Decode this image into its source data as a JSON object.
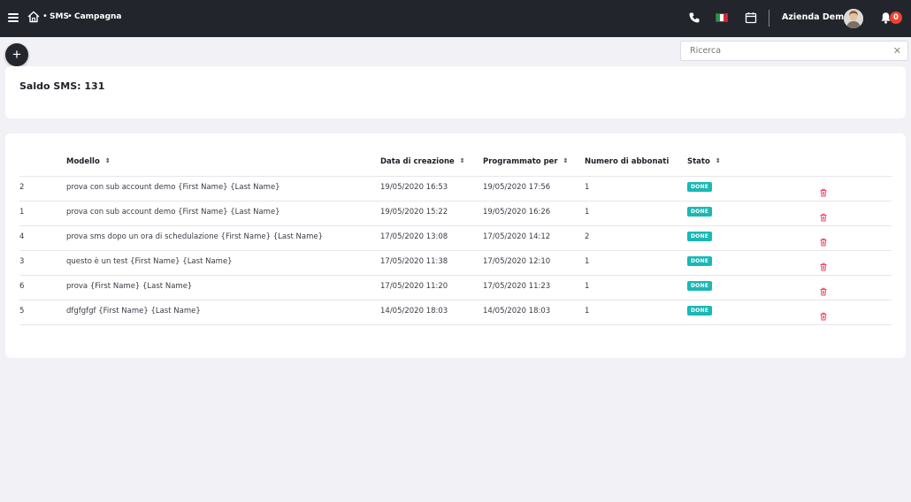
{
  "header": {
    "breadcrumb": [
      "SMS",
      "Campagna"
    ],
    "company_name": "Azienda Demo",
    "notification_count": "0",
    "icons": [
      "menu-icon",
      "home-icon",
      "phone-icon",
      "italian-flag-icon",
      "calendar-icon",
      "bell-icon"
    ]
  },
  "search": {
    "placeholder": "Ricerca",
    "value": ""
  },
  "balance": {
    "label": "Saldo SMS: 131"
  },
  "table": {
    "columns": [
      "Modello",
      "Data di creazione",
      "Programmato per",
      "Numero di abbonati",
      "Stato"
    ],
    "rows": [
      {
        "id": "2",
        "model": "prova con sub account demo {First Name} {Last Name}",
        "created": "19/05/2020 16:53",
        "scheduled": "19/05/2020 17:56",
        "subscribers": "1",
        "status": "DONE"
      },
      {
        "id": "1",
        "model": "prova con sub account demo {First Name} {Last Name}",
        "created": "19/05/2020 15:22",
        "scheduled": "19/05/2020 16:26",
        "subscribers": "1",
        "status": "DONE"
      },
      {
        "id": "4",
        "model": "prova sms dopo un ora di schedulazione {First Name} {Last Name}",
        "created": "17/05/2020 13:08",
        "scheduled": "17/05/2020 14:12",
        "subscribers": "2",
        "status": "DONE"
      },
      {
        "id": "3",
        "model": "questo è un test {First Name} {Last Name}",
        "created": "17/05/2020 11:38",
        "scheduled": "17/05/2020 12:10",
        "subscribers": "1",
        "status": "DONE"
      },
      {
        "id": "6",
        "model": "prova {First Name} {Last Name}",
        "created": "17/05/2020 11:20",
        "scheduled": "17/05/2020 11:23",
        "subscribers": "1",
        "status": "DONE"
      },
      {
        "id": "5",
        "model": "dfgfgfgf {First Name} {Last Name}",
        "created": "14/05/2020 18:03",
        "scheduled": "14/05/2020 18:03",
        "subscribers": "1",
        "status": "DONE"
      }
    ]
  },
  "colors": {
    "topbar": "#23252c",
    "status_done": "#1ab8b5",
    "badge": "#f0412f",
    "trash": "#e84a6a"
  }
}
